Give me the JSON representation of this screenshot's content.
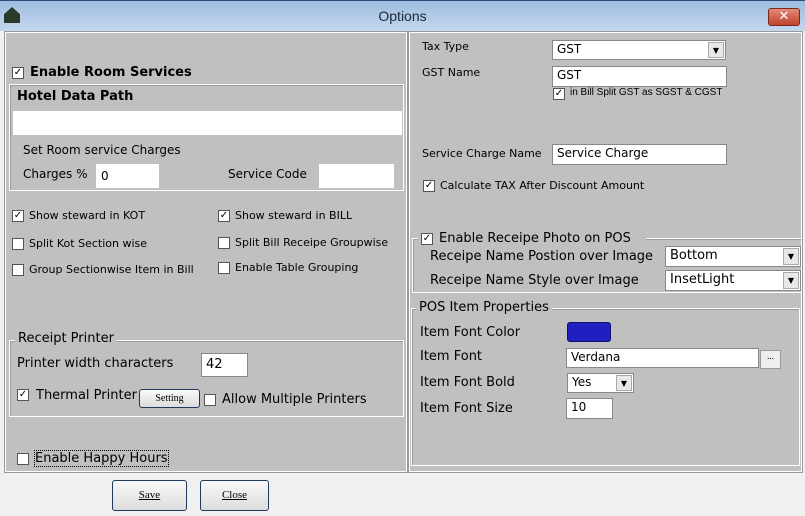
{
  "window": {
    "title": "Options",
    "icon": "app-house-icon",
    "close_icon": "close-icon"
  },
  "left": {
    "enable_room_services": {
      "label": "Enable Room Services",
      "checked": true
    },
    "hotel_data_path": {
      "label": "Hotel Data Path",
      "value": ""
    },
    "room_service_charges_label": "Set Room service Charges",
    "charges_percent": {
      "label": "Charges %",
      "value": "0"
    },
    "service_code": {
      "label": "Service Code",
      "value": ""
    },
    "options": [
      {
        "label": "Show steward in KOT",
        "checked": true
      },
      {
        "label": "Show steward in BILL",
        "checked": true
      },
      {
        "label": "Split Kot Section wise",
        "checked": false
      },
      {
        "label": "Split Bill Receipe Groupwise",
        "checked": false
      },
      {
        "label": "Group Sectionwise Item in Bill",
        "checked": false
      },
      {
        "label": "Enable Table Grouping",
        "checked": false
      }
    ],
    "receipt_printer": {
      "legend": "Receipt Printer",
      "width_label": "Printer width characters",
      "width_value": "42",
      "thermal_label": "Thermal Printer",
      "thermal_checked": true,
      "setting_button": "Setting",
      "multiple_label": "Allow Multiple Printers",
      "multiple_checked": false
    },
    "happy_hours": {
      "label": "Enable Happy Hours",
      "checked": false
    }
  },
  "right": {
    "tax_type": {
      "label": "Tax Type",
      "value": "GST"
    },
    "gst_name": {
      "label": "GST Name",
      "value": "GST"
    },
    "split_gst": {
      "label": "in Bill Split GST as SGST & CGST",
      "checked": true
    },
    "service_charge_name": {
      "label": "Service Charge Name",
      "value": "Service Charge"
    },
    "calc_tax": {
      "label": "Calculate TAX After Discount Amount",
      "checked": true
    },
    "receipe_photo": {
      "label": "Enable Receipe Photo on POS",
      "checked": true,
      "position_label": "Receipe Name Postion over Image",
      "position_value": "Bottom",
      "style_label": "Receipe Name Style over Image",
      "style_value": "InsetLight"
    },
    "pos_item": {
      "legend": "POS Item Properties",
      "color_label": "Item Font Color",
      "color": "#2020c0",
      "font_label": "Item Font",
      "font_value": "Verdana",
      "browse_label": "...",
      "bold_label": "Item Font Bold",
      "bold_value": "Yes",
      "size_label": "Item Font Size",
      "size_value": "10"
    }
  },
  "footer": {
    "save": "Save",
    "close": "Close"
  }
}
